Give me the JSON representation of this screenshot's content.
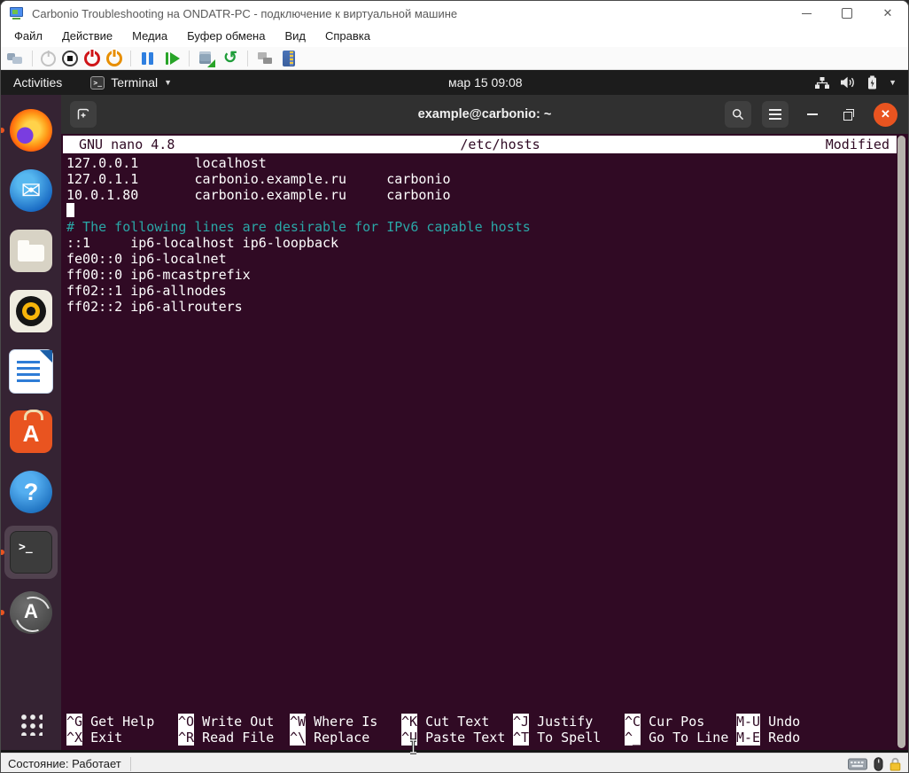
{
  "vm_window": {
    "title": "Carbonio Troubleshooting на ONDATR-PC - подключение к виртуальной машине",
    "menu_items": [
      "Файл",
      "Действие",
      "Медиа",
      "Буфер обмена",
      "Вид",
      "Справка"
    ],
    "toolbar_groups": [
      [
        "ctrl-alt-del"
      ],
      [
        "start",
        "turn-off",
        "shutdown",
        "save"
      ],
      [
        "pause",
        "reset"
      ],
      [
        "checkpoint",
        "revert"
      ],
      [
        "network",
        "enhanced-session"
      ]
    ],
    "status_text": "Состояние: Работает"
  },
  "desktop": {
    "topbar": {
      "activities": "Activities",
      "app_name": "Terminal",
      "clock": "мар 15  09:08"
    },
    "dock": [
      {
        "id": "firefox",
        "running": true,
        "active": false
      },
      {
        "id": "thunderbird",
        "running": false,
        "active": false
      },
      {
        "id": "files",
        "running": false,
        "active": false
      },
      {
        "id": "rhythmbox",
        "running": false,
        "active": false
      },
      {
        "id": "libreoffice-writer",
        "running": false,
        "active": false
      },
      {
        "id": "ubuntu-software",
        "running": false,
        "active": false
      },
      {
        "id": "help",
        "running": false,
        "active": false
      },
      {
        "id": "terminal",
        "running": true,
        "active": true
      },
      {
        "id": "software-updater",
        "running": true,
        "active": false
      }
    ]
  },
  "terminal": {
    "title": "example@carbonio: ~",
    "nano": {
      "app_version": "GNU nano 4.8",
      "filename": "/etc/hosts",
      "modified_label": "Modified",
      "lines": [
        {
          "text": "127.0.0.1       localhost",
          "type": "plain"
        },
        {
          "text": "127.0.1.1       carbonio.example.ru     carbonio",
          "type": "plain"
        },
        {
          "text": "10.0.1.80       carbonio.example.ru     carbonio",
          "type": "plain"
        },
        {
          "text": "",
          "type": "cursor"
        },
        {
          "text": "# The following lines are desirable for IPv6 capable hosts",
          "type": "comment"
        },
        {
          "text": "::1     ip6-localhost ip6-loopback",
          "type": "plain"
        },
        {
          "text": "fe00::0 ip6-localnet",
          "type": "plain"
        },
        {
          "text": "ff00::0 ip6-mcastprefix",
          "type": "plain"
        },
        {
          "text": "ff02::1 ip6-allnodes",
          "type": "plain"
        },
        {
          "text": "ff02::2 ip6-allrouters",
          "type": "plain"
        }
      ],
      "shortcut_rows": [
        [
          {
            "key": "^G",
            "label": "Get Help"
          },
          {
            "key": "^O",
            "label": "Write Out"
          },
          {
            "key": "^W",
            "label": "Where Is"
          },
          {
            "key": "^K",
            "label": "Cut Text"
          },
          {
            "key": "^J",
            "label": "Justify"
          },
          {
            "key": "^C",
            "label": "Cur Pos"
          },
          {
            "key": "M-U",
            "label": "Undo"
          }
        ],
        [
          {
            "key": "^X",
            "label": "Exit"
          },
          {
            "key": "^R",
            "label": "Read File"
          },
          {
            "key": "^\\",
            "label": "Replace"
          },
          {
            "key": "^U",
            "label": "Paste Text"
          },
          {
            "key": "^T",
            "label": "To Spell"
          },
          {
            "key": "^_",
            "label": "Go To Line"
          },
          {
            "key": "M-E",
            "label": "Redo"
          }
        ]
      ]
    }
  },
  "colors": {
    "ubuntu_orange": "#e95420",
    "terminal_bg": "#300a24",
    "comment_teal": "#2aa7a7",
    "topbar_bg": "#1c1c1c"
  }
}
